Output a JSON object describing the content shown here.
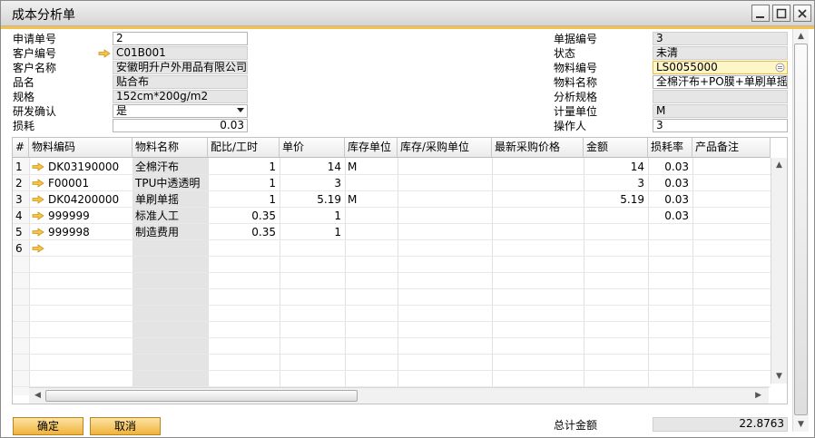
{
  "window": {
    "title": "成本分析单"
  },
  "left_fields": [
    {
      "label": "申请单号",
      "value": "2"
    },
    {
      "label": "客户编号",
      "value": "C01B001"
    },
    {
      "label": "客户名称",
      "value": "安徽明升户外用品有限公司"
    },
    {
      "label": "品名",
      "value": "贴合布"
    },
    {
      "label": "规格",
      "value": "152cm*200g/m2"
    },
    {
      "label": "研发确认",
      "value": "是"
    },
    {
      "label": "损耗",
      "value": "0.03"
    }
  ],
  "right_fields": [
    {
      "label": "单据编号",
      "value": "3"
    },
    {
      "label": "状态",
      "value": "未清"
    },
    {
      "label": "物料编号",
      "value": "LS0055000"
    },
    {
      "label": "物料名称",
      "value": "全棉汗布+PO膜+单刷单摇"
    },
    {
      "label": "分析规格",
      "value": ""
    },
    {
      "label": "计量单位",
      "value": "M"
    },
    {
      "label": "操作人",
      "value": "3"
    }
  ],
  "table": {
    "columns": [
      "#",
      "物料编码",
      "物料名称",
      "配比/工时",
      "单价",
      "库存单位",
      "库存/采购单位",
      "最新采购价格",
      "金额",
      "损耗率",
      "产品备注"
    ],
    "rows": [
      {
        "no": "1",
        "code": "DK03190000",
        "name": "全棉汗布",
        "ratio": "1",
        "price": "14",
        "unit": "M",
        "amount": "14",
        "loss": "0.03"
      },
      {
        "no": "2",
        "code": "F00001",
        "name": "TPU中透透明",
        "ratio": "1",
        "price": "3",
        "unit": "",
        "amount": "3",
        "loss": "0.03"
      },
      {
        "no": "3",
        "code": "DK04200000",
        "name": "单刷单摇",
        "ratio": "1",
        "price": "5.19",
        "unit": "M",
        "amount": "5.19",
        "loss": "0.03"
      },
      {
        "no": "4",
        "code": "999999",
        "name": "标准人工",
        "ratio": "0.35",
        "price": "1",
        "unit": "",
        "amount": "",
        "loss": "0.03"
      },
      {
        "no": "5",
        "code": "999998",
        "name": "制造费用",
        "ratio": "0.35",
        "price": "1",
        "unit": "",
        "amount": "",
        "loss": ""
      },
      {
        "no": "6",
        "code": "",
        "name": "",
        "ratio": "",
        "price": "",
        "unit": "",
        "amount": "",
        "loss": ""
      }
    ]
  },
  "footer": {
    "ok_label": "确定",
    "cancel_label": "取消",
    "total_label": "总计金额",
    "total_value": "22.8763"
  },
  "colors": {
    "accent": "#f4c24a",
    "button": "#f0b239",
    "link_arrow": "#f5c542"
  }
}
